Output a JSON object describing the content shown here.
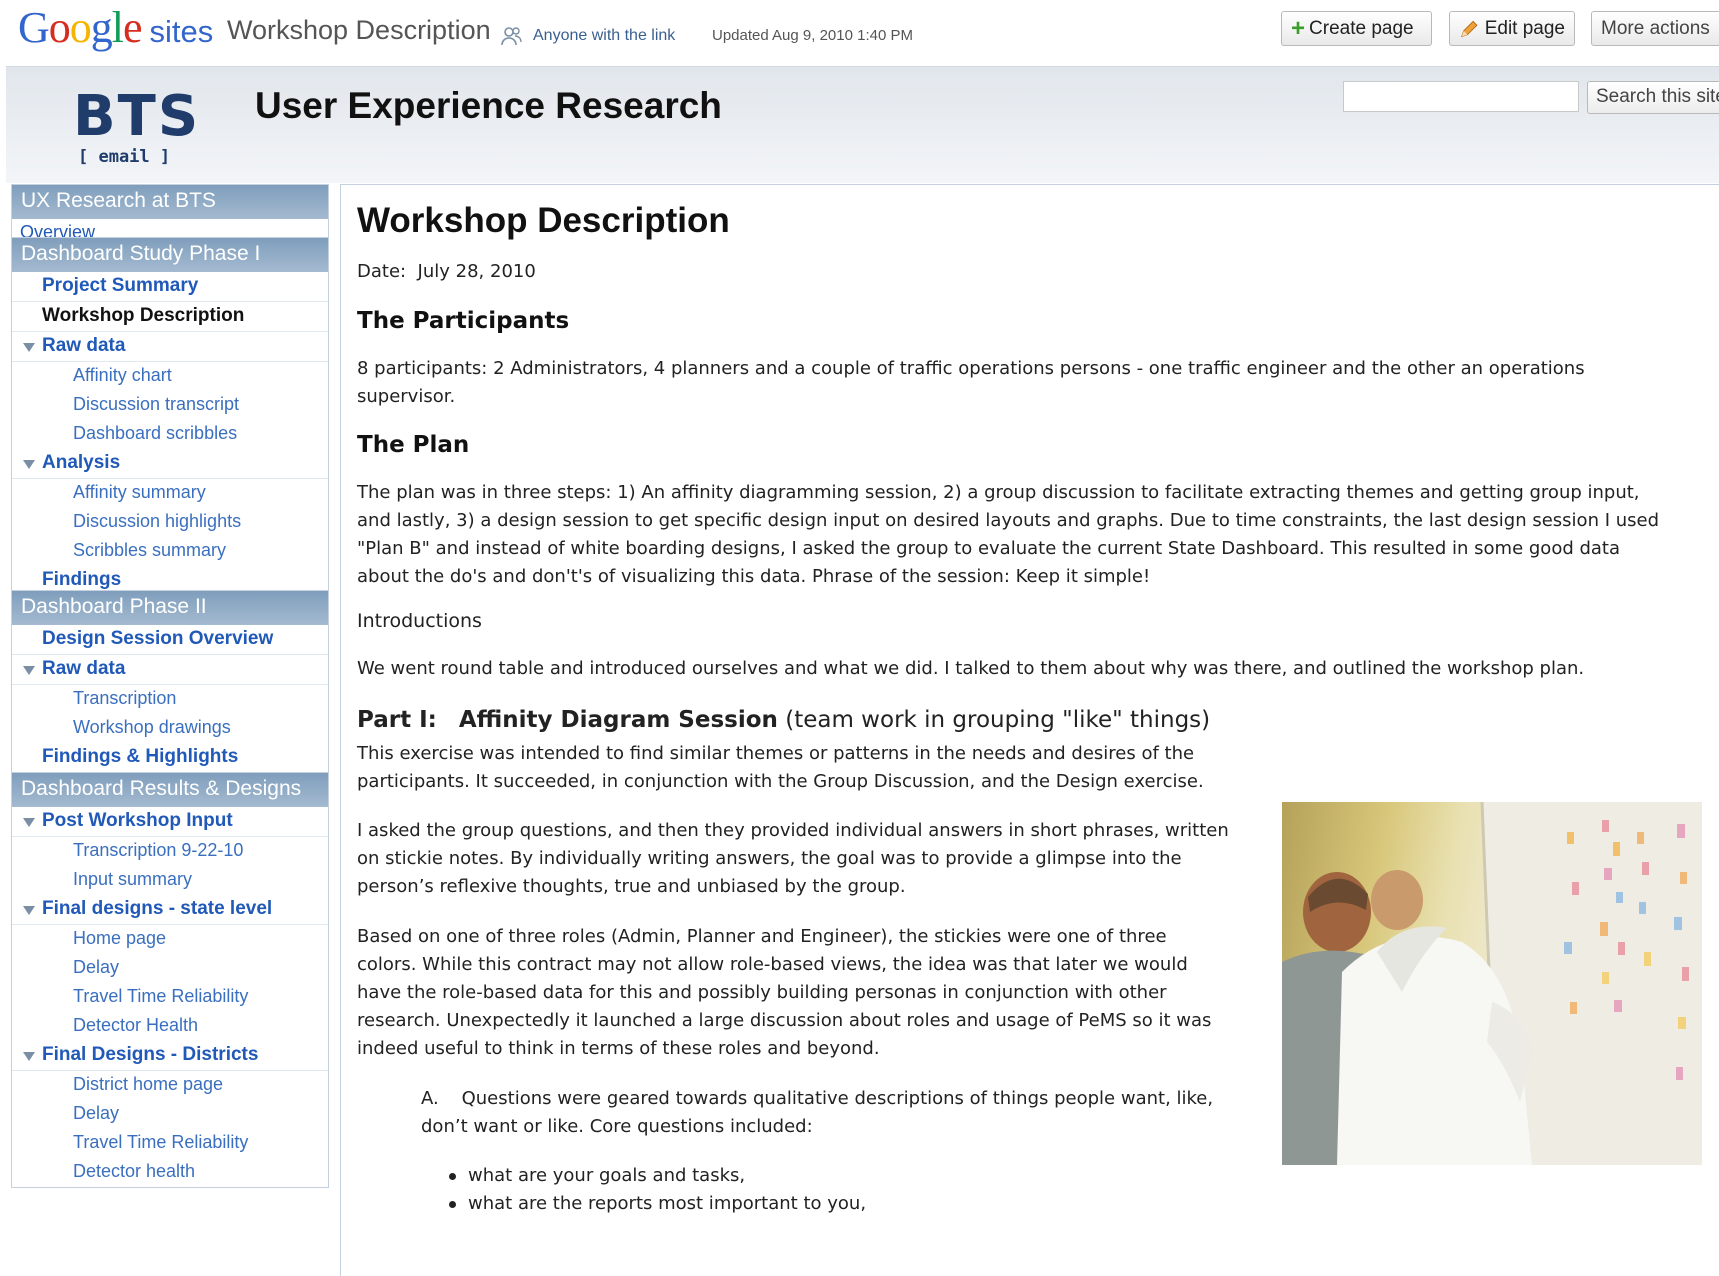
{
  "topbar": {
    "logo_google": "Google",
    "logo_sites": "sites",
    "page_name": "Workshop Description",
    "share_text": "Anyone with the link",
    "updated_text": "Updated Aug 9, 2010 1:40 PM",
    "create_page": "Create page",
    "edit_page": "Edit page",
    "more_actions": "More actions"
  },
  "header": {
    "logo_main": "BTS",
    "logo_sub": "[ email ]",
    "site_title": "User Experience Research",
    "search_value": "",
    "search_button": "Search this site"
  },
  "sidebar": [
    {
      "heading": "UX Research at BTS",
      "items": [
        {
          "label": "Overview",
          "level": 0,
          "plain": true
        }
      ]
    },
    {
      "heading": "Dashboard Study Phase I",
      "items": [
        {
          "label": "Project Summary",
          "level": 0
        },
        {
          "label": "Workshop Description",
          "level": 0,
          "current": true
        },
        {
          "label": "Raw data",
          "level": 0,
          "expanded": true
        },
        {
          "label": "Affinity chart",
          "level": 1
        },
        {
          "label": "Discussion transcript",
          "level": 1
        },
        {
          "label": "Dashboard scribbles",
          "level": 1
        },
        {
          "label": "Analysis",
          "level": 0,
          "expanded": true
        },
        {
          "label": "Affinity summary",
          "level": 1
        },
        {
          "label": "Discussion highlights",
          "level": 1
        },
        {
          "label": "Scribbles summary",
          "level": 1
        },
        {
          "label": "Findings",
          "level": 0
        }
      ]
    },
    {
      "heading": "Dashboard Phase II",
      "items": [
        {
          "label": "Design Session Overview",
          "level": 0
        },
        {
          "label": "Raw data",
          "level": 0,
          "expanded": true
        },
        {
          "label": "Transcription",
          "level": 1
        },
        {
          "label": "Workshop drawings",
          "level": 1
        },
        {
          "label": "Findings & Highlights",
          "level": 0
        }
      ]
    },
    {
      "heading": "Dashboard Results & Designs",
      "items": [
        {
          "label": "Post Workshop Input",
          "level": 0,
          "expanded": true
        },
        {
          "label": "Transcription 9-22-10",
          "level": 1
        },
        {
          "label": "Input summary",
          "level": 1
        },
        {
          "label": "Final designs - state level",
          "level": 0,
          "expanded": true
        },
        {
          "label": "Home page",
          "level": 1
        },
        {
          "label": "Delay",
          "level": 1
        },
        {
          "label": "Travel Time Reliability",
          "level": 1
        },
        {
          "label": "Detector Health",
          "level": 1
        },
        {
          "label": "Final Designs - Districts",
          "level": 0,
          "expanded": true
        },
        {
          "label": "District home page",
          "level": 1
        },
        {
          "label": "Delay",
          "level": 1
        },
        {
          "label": "Travel Time Reliability",
          "level": 1
        },
        {
          "label": "Detector health",
          "level": 1
        }
      ]
    }
  ],
  "content": {
    "title": "Workshop Description",
    "date_label": "Date:",
    "date_value": "July 28, 2010",
    "participants_heading": "The Participants",
    "participants_line1": "8 participants:  2 Administrators, 4 planners and a couple of traffic operations persons - one traffic engineer and the other an operations",
    "participants_line2": "supervisor.",
    "plan_heading": "The Plan",
    "plan_line1": "The plan was in three steps:  1) An affinity diagramming session, 2) a group discussion to facilitate extracting themes and getting group input,",
    "plan_line2": "and lastly, 3) a design session to get specific design input on desired layouts and graphs.  Due to time constraints, the last design session I used",
    "plan_line3": "\"Plan B\" and instead of white boarding designs, I asked the group to evaluate the current State Dashboard.   This resulted in some good data",
    "plan_line4": "about the do's and don't's of visualizing this data.  Phrase of the session:  Keep it simple!",
    "intro_heading": "Introductions",
    "intro_line": "We went round table and introduced ourselves and what we did.  I talked to them about  why was there, and outlined the workshop plan.",
    "part1_prefix": "Part I:",
    "part1_bold": "Affinity Diagram Session",
    "part1_rest": "(team work in grouping \"like\" things)",
    "part1_p1_line1": "This exercise was intended to find similar themes or patterns in the needs and desires of the",
    "part1_p1_line2": "participants.  It succeeded, in conjunction with the Group Discussion, and the Design exercise.",
    "part1_p2_line1": "I asked the group questions,  and then they provided individual answers in short phrases, written",
    "part1_p2_line2": "on stickie notes.  By individually writing answers, the goal was to provide a glimpse into the",
    "part1_p2_line3": "person’s reflexive thoughts, true and unbiased by the group.",
    "part1_p3_line1": "Based on one of three roles (Admin, Planner and Engineer), the stickies were one of three",
    "part1_p3_line2": "colors.   While this contract may not allow role-based views, the idea was that later we would",
    "part1_p3_line3": "have the role-based data for this and possibly building personas in conjunction with other",
    "part1_p3_line4": "research.  Unexpectedly it launched a large discussion about roles and usage of PeMS so it was",
    "part1_p3_line5": "indeed useful to think in terms of these roles and beyond.",
    "list_marker": "A.",
    "list_a_line1": "Questions were geared towards qualitative descriptions of things people want, like,",
    "list_a_line2": "don’t want or like.   Core questions included:",
    "bullets": [
      "what are your goals and tasks,",
      "what are the reports most important to you,"
    ]
  },
  "colors": {
    "google_blue": "#3366cc",
    "link_blue": "#2159b8",
    "nav_heading_bg": "#8fa9c4",
    "header_bg": "#e6eaef",
    "create_plus_green": "#3a9e2b"
  }
}
